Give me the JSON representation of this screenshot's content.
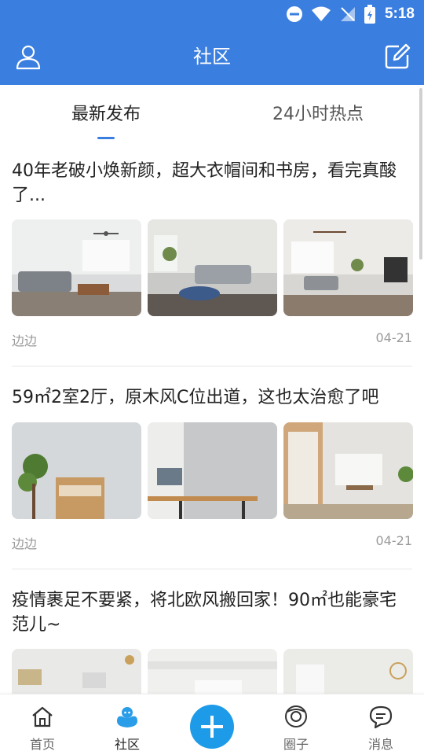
{
  "status_bar": {
    "time": "5:18"
  },
  "app_bar": {
    "title": "社区"
  },
  "tabs": [
    {
      "label": "最新发布",
      "active": true
    },
    {
      "label": "24小时热点",
      "active": false
    }
  ],
  "posts": [
    {
      "title": "40年老破小焕新颜，超大衣帽间和书房，看完真酸了...",
      "author": "边边",
      "date": "04-21",
      "images": [
        "living-room-photo",
        "living-room-photo",
        "living-room-photo"
      ]
    },
    {
      "title": "59㎡2室2厅，原木风C位出道，这也太治愈了吧",
      "author": "边边",
      "date": "04-21",
      "images": [
        "study-room-photo",
        "study-desk-photo",
        "study-room-photo"
      ]
    },
    {
      "title": "疫情裹足不要紧，将北欧风搬回家！90㎡也能豪宅范儿~",
      "author": "",
      "date": "",
      "images": [
        "dining-room-photo",
        "living-room-photo",
        "dining-room-photo"
      ]
    }
  ],
  "bottom_nav": [
    {
      "label": "首页",
      "icon": "home-icon",
      "active": false
    },
    {
      "label": "社区",
      "icon": "community-icon",
      "active": true
    },
    {
      "label": "",
      "icon": "plus-icon",
      "active": false
    },
    {
      "label": "圈子",
      "icon": "circle-icon",
      "active": false
    },
    {
      "label": "消息",
      "icon": "message-icon",
      "active": false
    }
  ],
  "colors": {
    "primary": "#3a7ee0",
    "fab": "#1e9be8",
    "text": "#222222",
    "muted": "#9a9a9a"
  }
}
